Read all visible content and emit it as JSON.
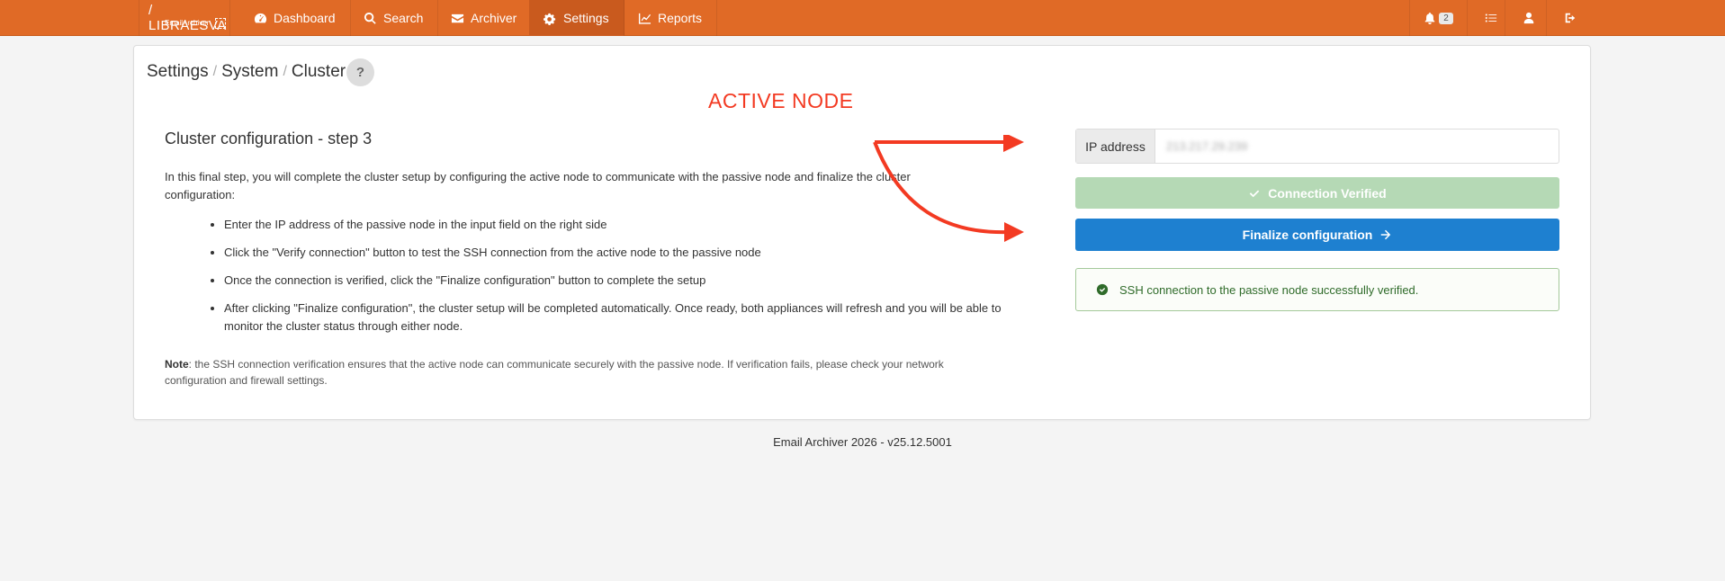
{
  "brand": {
    "name": "/ LIBRAESVA",
    "sub": "EmailArchiver"
  },
  "nav": {
    "items": [
      {
        "label": "Dashboard",
        "icon": "dashboard-icon"
      },
      {
        "label": "Search",
        "icon": "search-icon"
      },
      {
        "label": "Archiver",
        "icon": "envelope-icon"
      },
      {
        "label": "Settings",
        "icon": "gears-icon",
        "active": true
      },
      {
        "label": "Reports",
        "icon": "chart-icon"
      }
    ],
    "notification_count": "2"
  },
  "breadcrumb": {
    "part1": "Settings",
    "part2": "System",
    "part3": "Cluster",
    "sep": "/"
  },
  "help_label": "?",
  "annotation": "ACTIVE NODE",
  "step": {
    "title": "Cluster configuration - step 3",
    "intro": "In this final step, you will complete the cluster setup by configuring the active node to communicate with the passive node and finalize the cluster configuration:",
    "bullets": [
      "Enter the IP address of the passive node in the input field on the right side",
      "Click the \"Verify connection\" button to test the SSH connection from the active node to the passive node",
      "Once the connection is verified, click the \"Finalize configuration\" button to complete the setup",
      "After clicking \"Finalize configuration\", the cluster setup will be completed automatically. Once ready, both appliances will refresh and you will be able to monitor the cluster status through either node."
    ],
    "note_label": "Note",
    "note_text": ": the SSH connection verification ensures that the active node can communicate securely with the passive node. If verification fails, please check your network configuration and firewall settings."
  },
  "form": {
    "ip_label": "IP address",
    "ip_value": "213.217.29.239",
    "verified_label": "Connection Verified",
    "finalize_label": "Finalize configuration",
    "alert_text": "SSH connection to the passive node successfully verified."
  },
  "footer": "Email Archiver 2026 - v25.12.5001",
  "colors": {
    "navbar": "#e06a26",
    "primary": "#1e80d0",
    "success_light": "#b5d9b5",
    "annotation": "#f33a22"
  }
}
